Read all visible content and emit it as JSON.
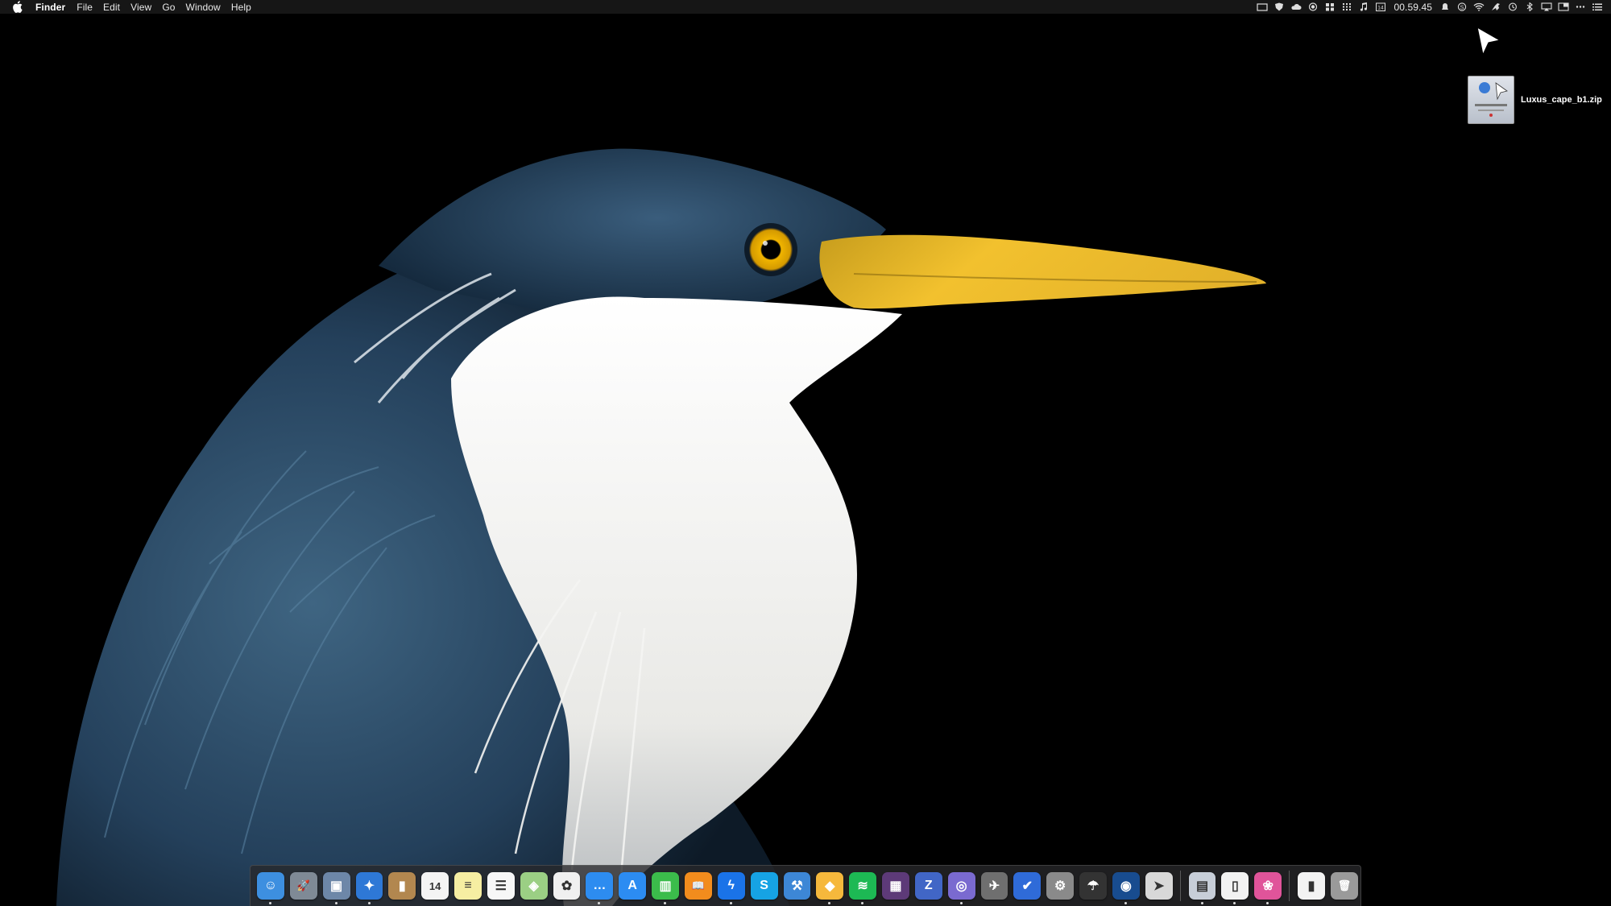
{
  "menubar": {
    "app_name": "Finder",
    "items": [
      "File",
      "Edit",
      "View",
      "Go",
      "Window",
      "Help"
    ],
    "clock": "00.59.45",
    "status_icons": [
      "display-icon",
      "shield-icon",
      "cloud-icon",
      "record-icon",
      "grid-icon",
      "calculator-grid-icon",
      "music-note-icon",
      "calendar-icon",
      "clock-text",
      "notification-icon",
      "skype-status-icon",
      "wifi-icon",
      "kangaroo-icon",
      "time-machine-icon",
      "bluetooth-icon",
      "airplay-icon",
      "display-mirror-icon",
      "more-icon",
      "list-icon"
    ],
    "calendar_day": "14"
  },
  "desktop": {
    "file_name": "Luxus_cape_b1.zip"
  },
  "dock": {
    "apps": [
      {
        "name": "finder-icon",
        "bg": "#3d8fe0",
        "glyph": "☺",
        "running": true
      },
      {
        "name": "launchpad-icon",
        "bg": "#7f8a96",
        "glyph": "🚀",
        "running": false
      },
      {
        "name": "preview-icon",
        "bg": "#6d87a8",
        "glyph": "▣",
        "running": true
      },
      {
        "name": "safari-icon",
        "bg": "#2e78d6",
        "glyph": "✦",
        "running": true
      },
      {
        "name": "contacts-icon",
        "bg": "#b2874f",
        "glyph": "▮",
        "running": false
      },
      {
        "name": "calendar-icon",
        "bg": "#f4f4f4",
        "glyph": "14",
        "running": false
      },
      {
        "name": "notes-icon",
        "bg": "#f6eea2",
        "glyph": "≡",
        "running": false
      },
      {
        "name": "reminders-icon",
        "bg": "#f7f7f7",
        "glyph": "☰",
        "running": false
      },
      {
        "name": "maps-icon",
        "bg": "#9bcf84",
        "glyph": "◈",
        "running": false
      },
      {
        "name": "photos-icon",
        "bg": "#f0f0f0",
        "glyph": "✿",
        "running": false
      },
      {
        "name": "messages-icon",
        "bg": "#2d8cf0",
        "glyph": "…",
        "running": true
      },
      {
        "name": "app-store-icon",
        "bg": "#2c8cf2",
        "glyph": "A",
        "running": false
      },
      {
        "name": "numbers-icon",
        "bg": "#3bbc4b",
        "glyph": "▥",
        "running": true
      },
      {
        "name": "books-icon",
        "bg": "#f28c1d",
        "glyph": "📖",
        "running": false
      },
      {
        "name": "messenger-icon",
        "bg": "#1a73e8",
        "glyph": "ϟ",
        "running": true
      },
      {
        "name": "skype-icon",
        "bg": "#16a3e4",
        "glyph": "S",
        "running": false
      },
      {
        "name": "xcode-icon",
        "bg": "#3d87d6",
        "glyph": "⚒",
        "running": false
      },
      {
        "name": "sketch-icon",
        "bg": "#f6b83c",
        "glyph": "◆",
        "running": true
      },
      {
        "name": "spotify-icon",
        "bg": "#1db954",
        "glyph": "≋",
        "running": true
      },
      {
        "name": "calculator-icon",
        "bg": "#5d3a78",
        "glyph": "▦",
        "running": false
      },
      {
        "name": "textedit-icon",
        "bg": "#4166c6",
        "glyph": "Z",
        "running": false
      },
      {
        "name": "proxy-icon",
        "bg": "#7a6ad0",
        "glyph": "◎",
        "running": true
      },
      {
        "name": "automator-icon",
        "bg": "#6f6f6f",
        "glyph": "✈",
        "running": false
      },
      {
        "name": "wunderlist-check-icon",
        "bg": "#2f6bd8",
        "glyph": "✔",
        "running": false
      },
      {
        "name": "system-preferences-icon",
        "bg": "#8a8a8a",
        "glyph": "⚙",
        "running": false
      },
      {
        "name": "parachute-icon",
        "bg": "#333333",
        "glyph": "☂",
        "running": false
      },
      {
        "name": "browser-icon",
        "bg": "#184c8f",
        "glyph": "◉",
        "running": true
      },
      {
        "name": "cursor-app-icon",
        "bg": "#d8d8d8",
        "glyph": "➤",
        "running": false
      },
      {
        "name": "separator",
        "bg": "",
        "glyph": "",
        "running": false
      },
      {
        "name": "image-folder-icon",
        "bg": "#c7ced8",
        "glyph": "▤",
        "running": true
      },
      {
        "name": "document-icon",
        "bg": "#f2f2f2",
        "glyph": "▯",
        "running": true
      },
      {
        "name": "photo-app-icon",
        "bg": "#e0549a",
        "glyph": "❀",
        "running": true
      },
      {
        "name": "separator",
        "bg": "",
        "glyph": "",
        "running": false
      },
      {
        "name": "archive-icon",
        "bg": "#f3f3f3",
        "glyph": "▮",
        "running": false
      },
      {
        "name": "trash-icon",
        "bg": "#9a9a9a",
        "glyph": "🗑",
        "running": false
      }
    ]
  },
  "colors": {
    "menubar_bg": "#161616",
    "beak": "#f2c12e",
    "feathers_blue": "#2d4a67",
    "white_breast": "#f2f2f0"
  }
}
